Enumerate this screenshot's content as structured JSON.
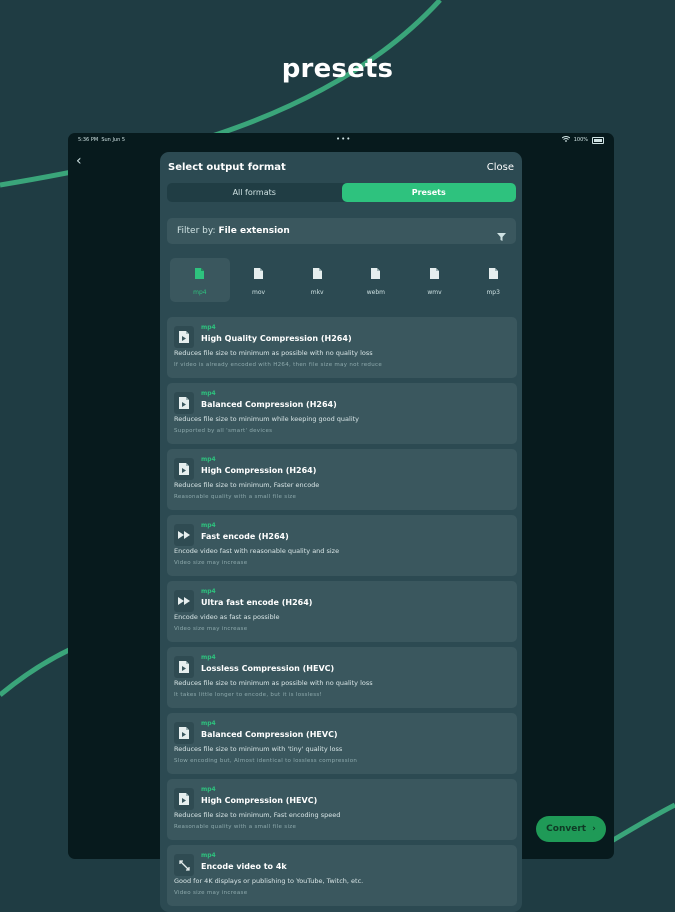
{
  "headline": "presets",
  "status_bar": {
    "time": "5:36 PM",
    "date": "Sun Jun 5",
    "battery": "100%"
  },
  "sheet": {
    "title": "Select output format",
    "close_label": "Close",
    "tabs": [
      {
        "label": "All formats",
        "active": false
      },
      {
        "label": "Presets",
        "active": true
      }
    ],
    "filter": {
      "prefix": "Filter by:",
      "value": "File extension"
    },
    "formats": [
      {
        "label": "mp4",
        "active": true
      },
      {
        "label": "mov",
        "active": false
      },
      {
        "label": "mkv",
        "active": false
      },
      {
        "label": "webm",
        "active": false
      },
      {
        "label": "wmv",
        "active": false
      },
      {
        "label": "mp3",
        "active": false
      }
    ],
    "presets": [
      {
        "format": "mp4",
        "icon": "file-video-icon",
        "title": "High Quality Compression (H264)",
        "description": "Reduces file size to minimum as possible with no quality loss",
        "note": "If video is already encoded with H264, then file size may not reduce"
      },
      {
        "format": "mp4",
        "icon": "file-video-icon",
        "title": "Balanced Compression (H264)",
        "description": "Reduces file size to minimum while keeping good quality",
        "note": "Supported by all 'smart' devices"
      },
      {
        "format": "mp4",
        "icon": "file-video-icon",
        "title": "High Compression (H264)",
        "description": "Reduces file size to minimum, Faster encode",
        "note": "Reasonable quality with a small file size"
      },
      {
        "format": "mp4",
        "icon": "fast-forward-icon",
        "title": "Fast encode (H264)",
        "description": "Encode video fast with reasonable quality and size",
        "note": "Video size may increase"
      },
      {
        "format": "mp4",
        "icon": "fast-forward-icon",
        "title": "Ultra fast encode (H264)",
        "description": "Encode video as fast as possible",
        "note": "Video size may increase"
      },
      {
        "format": "mp4",
        "icon": "file-video-icon",
        "title": "Lossless Compression (HEVC)",
        "description": "Reduces file size to minimum as possible with no quality loss",
        "note": "It takes little longer to encode, but it is lossless!"
      },
      {
        "format": "mp4",
        "icon": "file-video-icon",
        "title": "Balanced Compression (HEVC)",
        "description": "Reduces file size to minimum with 'tiny' quality loss",
        "note": "Slow encoding but, Almost identical to lossless compression"
      },
      {
        "format": "mp4",
        "icon": "file-video-icon",
        "title": "High Compression (HEVC)",
        "description": "Reduces file size to minimum, Fast encoding speed",
        "note": "Reasonable quality with a small file size"
      },
      {
        "format": "mp4",
        "icon": "expand-icon",
        "title": "Encode video to 4k",
        "description": "Good for 4K displays or publishing to YouTube, Twitch, etc.",
        "note": "Video size may increase"
      }
    ]
  },
  "convert_label": "Convert",
  "colors": {
    "background": "#1f3c43",
    "accent": "#2ec27e",
    "sheet": "#2c4a52",
    "card": "#3a575e",
    "device": "#071a1d"
  }
}
